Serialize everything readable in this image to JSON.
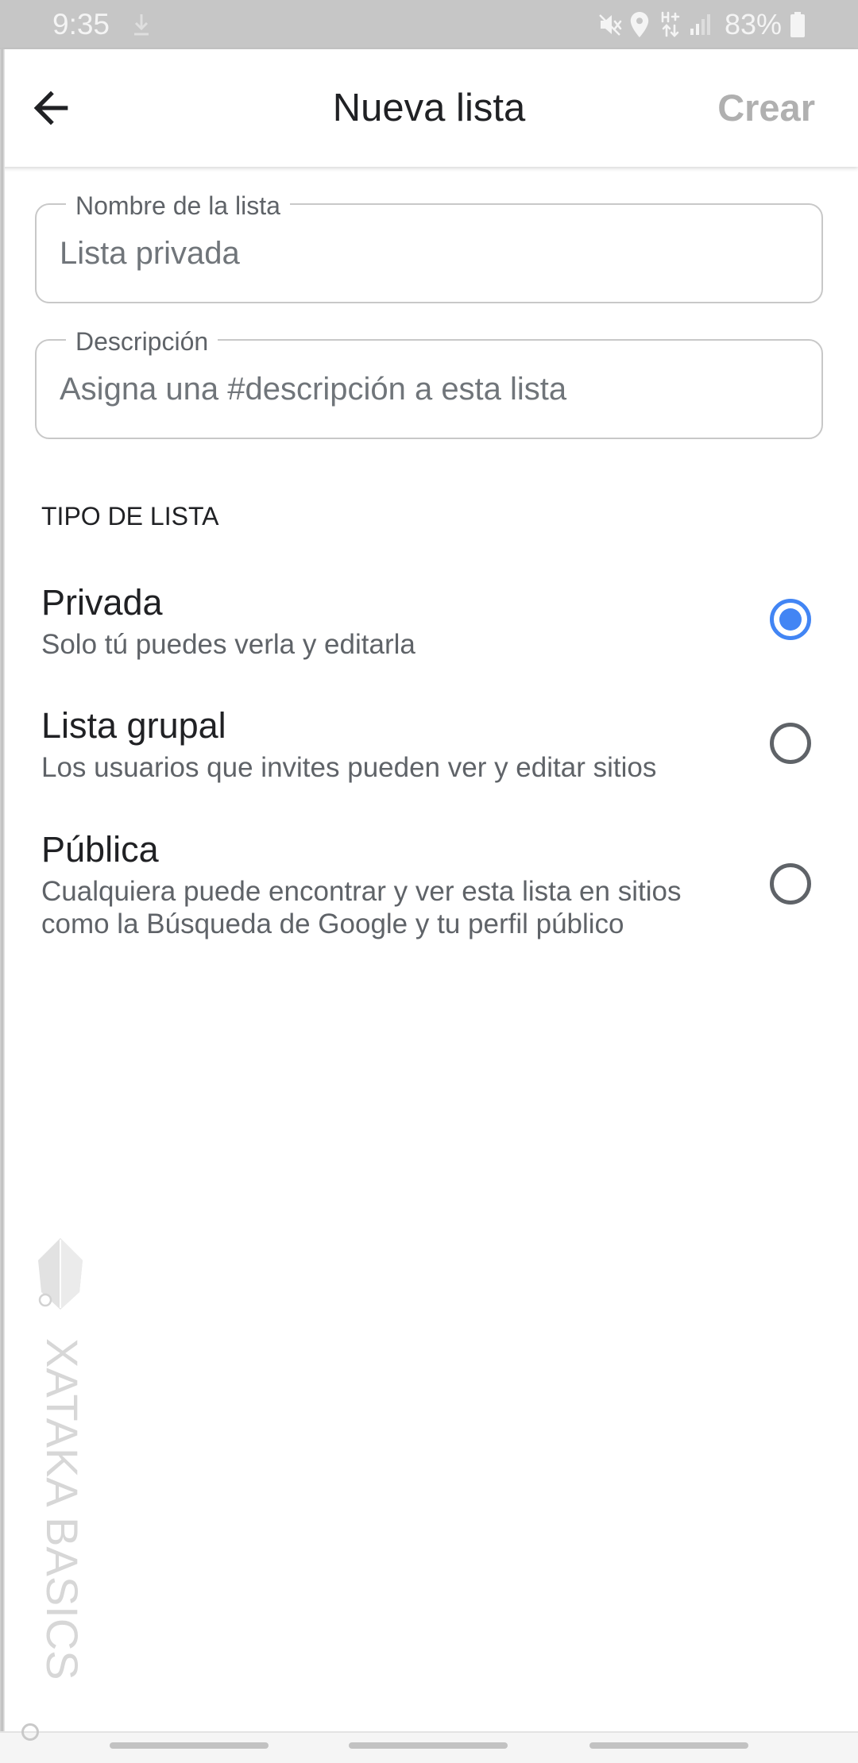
{
  "status_bar": {
    "time": "9:35",
    "battery_percent": "83%",
    "icons": [
      "download-icon",
      "mute-icon",
      "location-icon",
      "mobile-data-hplus-icon",
      "signal-icon",
      "battery-icon"
    ]
  },
  "app_bar": {
    "back_icon": "arrow-back-icon",
    "title": "Nueva lista",
    "create_label": "Crear",
    "create_enabled": false
  },
  "form": {
    "name_field": {
      "label": "Nombre de la lista",
      "placeholder": "Lista privada"
    },
    "description_field": {
      "label": "Descripción",
      "placeholder": "Asigna una #descripción a esta lista"
    }
  },
  "list_type": {
    "heading": "TIPO DE LISTA",
    "options": [
      {
        "title": "Privada",
        "subtitle": "Solo tú puedes verla y editarla",
        "selected": true
      },
      {
        "title": "Lista grupal",
        "subtitle": "Los usuarios que invites pueden ver y editar sitios",
        "selected": false
      },
      {
        "title": "Pública",
        "subtitle": "Cualquiera puede encontrar y ver esta lista en sitios como la Búsqueda de Google y tu perfil público",
        "selected": false
      }
    ]
  },
  "watermark": {
    "text": "XATAKA BASICS"
  },
  "colors": {
    "status_bar_bg": "#c6c6c6",
    "status_bar_fg": "#f4f4f4",
    "accent": "#4285f4",
    "text_primary": "#202124",
    "text_secondary": "#5f6368",
    "text_hint": "#70757a",
    "create_disabled": "#b0b0b0",
    "field_border": "#c8c8c8",
    "radio_off": "#5f6368",
    "watermark": "#d7d7d7",
    "nav_bg": "#f5f5f5",
    "nav_handle": "#c2c2c2"
  }
}
